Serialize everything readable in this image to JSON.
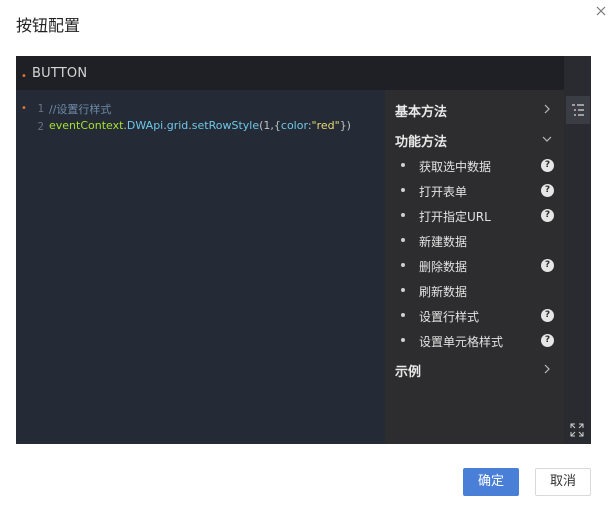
{
  "dialog": {
    "title": "按钮配置",
    "close_icon": "close-icon"
  },
  "editor": {
    "tab_label": "BUTTON",
    "lines": [
      {
        "number": "1",
        "tokens": {
          "comment": "//设置行样式"
        }
      },
      {
        "number": "2",
        "tokens": {
          "obj": "eventContext",
          "dot1": ".",
          "api": "DWApi",
          "dot2": ".",
          "grid": "grid",
          "dot3": ".",
          "method": "setRowStyle",
          "open": "(1,{",
          "key": "color",
          "colon": ":",
          "value": "\"red\"",
          "close": "})"
        }
      }
    ]
  },
  "helper": {
    "sections": [
      {
        "title": "基本方法",
        "chevron": "chevron-right-icon"
      },
      {
        "title": "功能方法",
        "chevron": "chevron-down-icon",
        "items": [
          {
            "label": "获取选中数据",
            "help": "?"
          },
          {
            "label": "打开表单",
            "help": "?"
          },
          {
            "label": "打开指定URL",
            "help": "?"
          },
          {
            "label": "新建数据"
          },
          {
            "label": "删除数据",
            "help": "?"
          },
          {
            "label": "刷新数据"
          },
          {
            "label": "设置行样式",
            "help": "?"
          },
          {
            "label": "设置单元格样式",
            "help": "?"
          }
        ]
      },
      {
        "title": "示例",
        "chevron": "chevron-right-icon"
      }
    ]
  },
  "rail": {
    "toggle_icon": "outline-list-icon",
    "expand_icon": "fullscreen-icon"
  },
  "footer": {
    "confirm_label": "确定",
    "cancel_label": "取消"
  },
  "colors": {
    "primary": "#4a7fd8",
    "editor_bg": "#242a36",
    "helper_bg": "#2d2d2f",
    "marker": "#e0753a"
  }
}
